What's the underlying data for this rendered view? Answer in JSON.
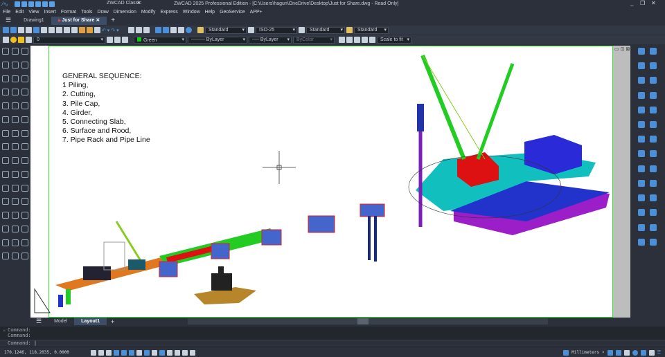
{
  "titlebar": {
    "workspace": "ZWCAD Classic",
    "title": "ZWCAD 2025 Professional Edition - [C:\\Users\\hagun\\OneDrive\\Desktop\\Just for Share.dwg - Read Only]"
  },
  "menu": [
    "File",
    "Edit",
    "View",
    "Insert",
    "Format",
    "Tools",
    "Draw",
    "Dimension",
    "Modify",
    "Express",
    "Window",
    "Help",
    "GeoService",
    "APP+"
  ],
  "tabs": [
    "Drawing1",
    "Just for Share"
  ],
  "styles": {
    "text": "Standard",
    "dim": "ISO-25",
    "table": "Standard",
    "multileader": "Standard"
  },
  "layer": {
    "name": "0",
    "color": "Green",
    "linetype": "ByLayer",
    "lineweight": "ByLayer",
    "plotstyle": "ByColor",
    "scale": "Scale to fit"
  },
  "drawing": {
    "heading": "GENERAL SEQUENCE:",
    "steps": [
      "1 Piling,",
      "2. Cutting,",
      "3. Pile Cap,",
      "4. Girder,",
      "5. Connecting Slab,",
      "6. Surface and Rood,",
      "7. Pipe Rack and Pipe Line"
    ]
  },
  "layout_tabs": [
    "Model",
    "Layout1"
  ],
  "command": {
    "history": [
      "Command:",
      "Command:"
    ],
    "prompt": "Command:"
  },
  "status": {
    "coords": "170.1246, 118.2035, 0.0000",
    "units": "Millimeters"
  }
}
